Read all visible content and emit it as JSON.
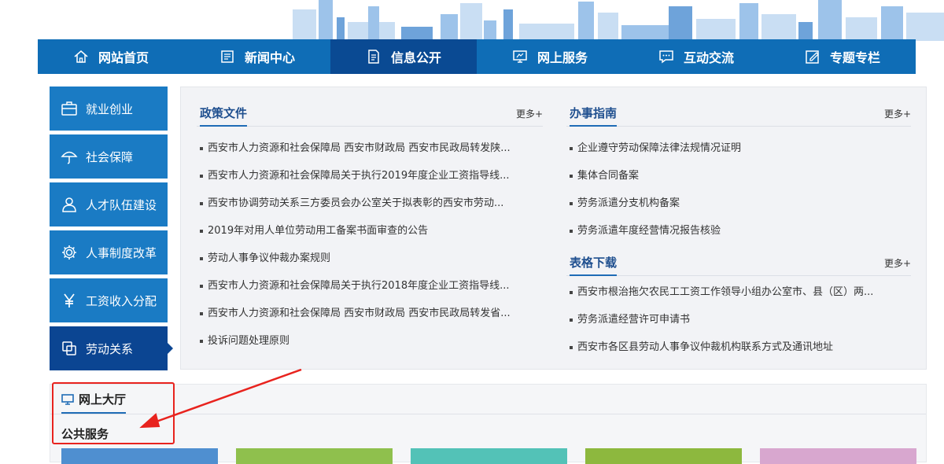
{
  "topnav": [
    {
      "label": "网站首页",
      "icon": "home-icon",
      "active": false
    },
    {
      "label": "新闻中心",
      "icon": "news-icon",
      "active": false
    },
    {
      "label": "信息公开",
      "icon": "document-icon",
      "active": true
    },
    {
      "label": "网上服务",
      "icon": "monitor-icon",
      "active": false
    },
    {
      "label": "互动交流",
      "icon": "chat-icon",
      "active": false
    },
    {
      "label": "专题专栏",
      "icon": "edit-icon",
      "active": false
    }
  ],
  "sidemenu": [
    {
      "label": "就业创业",
      "icon": "briefcase-icon",
      "active": false
    },
    {
      "label": "社会保障",
      "icon": "umbrella-icon",
      "active": false
    },
    {
      "label": "人才队伍建设",
      "icon": "person-icon",
      "active": false
    },
    {
      "label": "人事制度改革",
      "icon": "gear-icon",
      "active": false
    },
    {
      "label": "工资收入分配",
      "icon": "yen-icon",
      "active": false
    },
    {
      "label": "劳动关系",
      "icon": "copy-icon",
      "active": true
    }
  ],
  "policy": {
    "title": "政策文件",
    "more": "更多+",
    "items": [
      "西安市人力资源和社会保障局 西安市财政局 西安市民政局转发陕...",
      "西安市人力资源和社会保障局关于执行2019年度企业工资指导线...",
      "西安市协调劳动关系三方委员会办公室关于拟表彰的西安市劳动...",
      "2019年对用人单位劳动用工备案书面审查的公告",
      "劳动人事争议仲裁办案规则",
      "西安市人力资源和社会保障局关于执行2018年度企业工资指导线...",
      "西安市人力资源和社会保障局 西安市财政局 西安市民政局转发省...",
      "投诉问题处理原则"
    ]
  },
  "guide": {
    "title": "办事指南",
    "more": "更多+",
    "items": [
      "企业遵守劳动保障法律法规情况证明",
      "集体合同备案",
      "劳务派遣分支机构备案",
      "劳务派遣年度经营情况报告核验"
    ]
  },
  "forms": {
    "title": "表格下载",
    "more": "更多+",
    "items": [
      "西安市根治拖欠农民工工资工作领导小组办公室市、县（区）两...",
      "劳务派遣经营许可申请书",
      "西安市各区县劳动人事争议仲裁机构联系方式及通讯地址"
    ]
  },
  "online_hall": {
    "title": "网上大厅",
    "subtitle": "公共服务",
    "tile_colors": [
      "#4f8fd0",
      "#8fc04d",
      "#53c2b7",
      "#8db83e",
      "#d8a7cf"
    ]
  },
  "colors": {
    "nav": "#0f6db6",
    "nav_active": "#0a4a93",
    "side": "#1a7bc4",
    "side_active": "#0b4592",
    "annotation": "#e8231e"
  }
}
